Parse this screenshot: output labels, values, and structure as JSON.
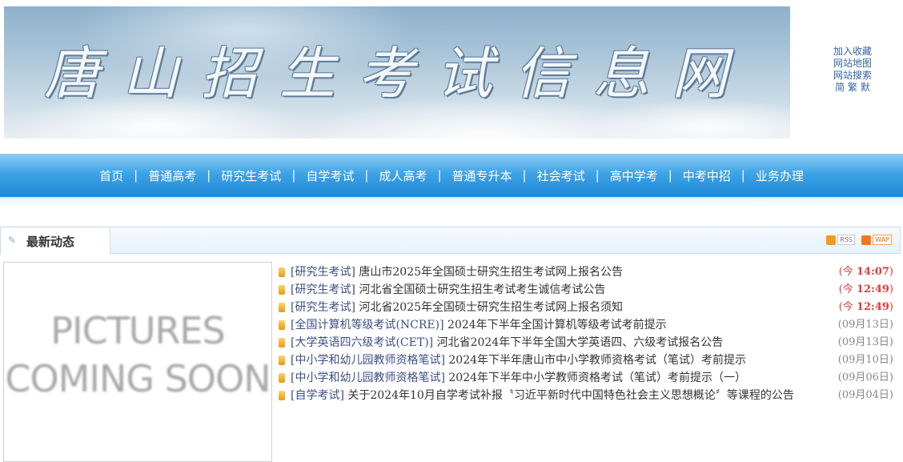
{
  "banner": {
    "title": "唐山招生考试信息网"
  },
  "top_links": {
    "favorite": "加入收藏",
    "sitemap": "网站地图",
    "search": "网站搜索",
    "lang_simplified": "简",
    "lang_traditional": "繁",
    "lang_default": "默"
  },
  "nav": {
    "separator": "|",
    "items": [
      "首页",
      "普通高考",
      "研究生考试",
      "自学考试",
      "成人高考",
      "普通专升本",
      "社会考试",
      "高中学考",
      "中考中招",
      "业务办理"
    ]
  },
  "section": {
    "title": "最新动态",
    "rss_label": "RSS",
    "wap_label": "WAP"
  },
  "picture_placeholder": {
    "line1": "PICTURES",
    "line2": "COMING SOON"
  },
  "news": [
    {
      "category": "[研究生考试]",
      "title": "唐山市2025年全国硕士研究生招生考试网上报名公告",
      "date_prefix": "(今 ",
      "date": "14:07",
      "date_suffix": ")"
    },
    {
      "category": "[研究生考试]",
      "title": "河北省全国硕士研究生招生考试考生诚信考试公告",
      "date_prefix": "(今 ",
      "date": "12:49",
      "date_suffix": ")"
    },
    {
      "category": "[研究生考试]",
      "title": "河北省2025年全国硕士研究生招生考试网上报名须知",
      "date_prefix": "(今 ",
      "date": "12:49",
      "date_suffix": ")"
    },
    {
      "category": "[全国计算机等级考试(NCRE)]",
      "title": "2024年下半年全国计算机等级考试考前提示",
      "date_full": "(09月13日)"
    },
    {
      "category": "[大学英语四六级考试(CET)]",
      "title": "河北省2024年下半年全国大学英语四、六级考试报名公告",
      "date_full": "(09月13日)"
    },
    {
      "category": "[中小学和幼儿园教师资格笔试]",
      "title": "2024年下半年唐山市中小学教师资格考试（笔试）考前提示",
      "date_full": "(09月10日)"
    },
    {
      "category": "[中小学和幼儿园教师资格笔试]",
      "title": "2024年下半年中小学教师资格考试（笔试）考前提示（一）",
      "date_full": "(09月06日)"
    },
    {
      "category": "[自学考试]",
      "title": "关于2024年10月自学考试补报〝习近平新时代中国特色社会主义思想概论〞等课程的公告",
      "date_full": "(09月04日)"
    }
  ]
}
